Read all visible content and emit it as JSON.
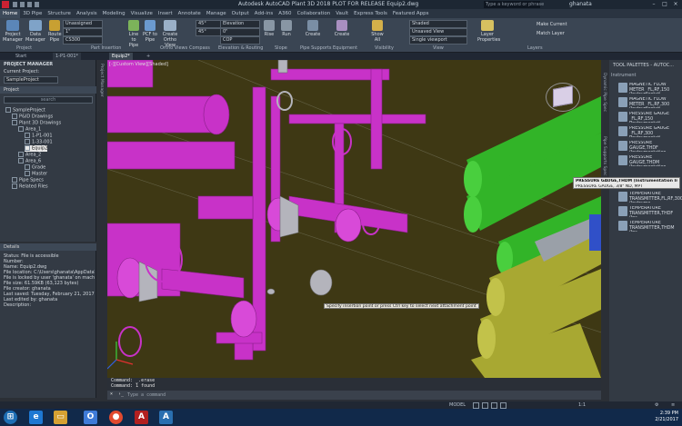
{
  "titlebar": {
    "title": "Autodesk AutoCAD Plant 3D 2018   PLOT FOR RELEASE   Equip2.dwg",
    "search_placeholder": "Type a keyword or phrase",
    "user": "ghanata"
  },
  "ribbon_tabs": [
    "Home",
    "3D Pipe",
    "Structure",
    "Analysis",
    "Modeling",
    "Visualize",
    "Insert",
    "Annotate",
    "Manage",
    "Output",
    "Add-ins",
    "A360",
    "Collaboration",
    "Vault",
    "Express Tools",
    "Featured Apps"
  ],
  "ribbon": {
    "buttons": {
      "project_manager": "Project Manager",
      "data_manager": "Data Manager",
      "route_pipe": "Route Pipe",
      "line_to_pipe": "Line to Pipe",
      "pcf_to_pipe": "PCF to Pipe",
      "create_ortho_view": "Create Ortho View",
      "rise": "Rise",
      "run": "Run",
      "create1": "Create",
      "create2": "Create",
      "show_all": "Show All",
      "layer_properties": "Layer Properties",
      "make_current": "Make Current",
      "match_layer": "Match Layer"
    },
    "selects": {
      "line_spec": "Unassigned",
      "size": "1\"",
      "spec": "CS300",
      "angle1": "45°",
      "angle2": "45°",
      "elevation_label": "Elevation",
      "elevation_value": "0\"",
      "cop": "COP",
      "visual_style": "Shaded",
      "view": "Unsaved View",
      "viewport": "Single viewport"
    },
    "groups": {
      "project": "Project",
      "part_insertion": "Part Insertion",
      "ortho_views": "Ortho Views",
      "compass": "Compass",
      "elevation_routing": "Elevation & Routing",
      "slope": "Slope",
      "pipe_supports": "Pipe Supports",
      "equipment": "Equipment",
      "visibility": "Visibility",
      "view": "View",
      "layers": "Layers"
    }
  },
  "file_tabs": [
    "Start",
    "1-P1-001*",
    "Equip2*"
  ],
  "project_manager": {
    "header": "PROJECT MANAGER",
    "current_project_label": "Current Project:",
    "current_project": "SampleProject",
    "panel_title": "Project",
    "search_placeholder": "search",
    "tree": [
      {
        "label": "SampleProject",
        "indent": 0
      },
      {
        "label": "P&ID Drawings",
        "indent": 1
      },
      {
        "label": "Plant 3D Drawings",
        "indent": 1
      },
      {
        "label": "Area_1",
        "indent": 2
      },
      {
        "label": "1-P1-001",
        "indent": 3
      },
      {
        "label": "1-33-001",
        "indent": 3
      },
      {
        "label": "Equip2",
        "indent": 3
      },
      {
        "label": "Area_2",
        "indent": 2
      },
      {
        "label": "Area_6",
        "indent": 2
      },
      {
        "label": "Grade",
        "indent": 3
      },
      {
        "label": "Master",
        "indent": 3
      },
      {
        "label": "Pipe Specs",
        "indent": 1
      },
      {
        "label": "Related Files",
        "indent": 1
      }
    ]
  },
  "details": {
    "header": "Details",
    "lines": [
      "Status: File is accessible",
      "Number:",
      "Name: Equip2.dwg",
      "File location: C:\\Users\\ghanata\\AppData\\Roam",
      "File is locked by user 'ghanata' on machine 'XXX",
      "File size: 61.59KB (63,123 bytes)",
      "File creator: ghanata",
      "Last saved: Tuesday, February 21, 2017 1:44:27",
      "Last edited by: ghanata",
      "Description:"
    ]
  },
  "viewport": {
    "label": "[-][Custom View][Shaded]",
    "prompt": "Specify insertion point or press Ctrl key to select next attachment point"
  },
  "command": {
    "line1": "Command: _.erase",
    "line2": "Command: 1 found",
    "placeholder": "Type a command"
  },
  "tool_palette": {
    "header": "TOOL PALETTES - AUTOC...",
    "section": "Instrument",
    "items": [
      "MAGNETIC FLOW METER _FL,RF,150 (Instrumentati",
      "MAGNETIC FLOW METER _FL,RF,300 (Instrumentati",
      "PRESSURE GAUGE _FL,RF,150 (Instrumentati",
      "PRESSURE GAUGE _FL,RF,300 (Instrumentati",
      "PRESSURE GAUGE,THDF (Instrumentation Imperial)",
      "PRESSURE GAUGE,THDM (Instrumentation Imperial)"
    ],
    "tooltip_title": "PRESSURE GAUGE,THDM (Instrumentation Imperial)",
    "tooltip_sub": "PRESSURE GAUGE, 3/8\" ND, MPT",
    "more_items": [
      "TEMPERATURE TRANSMITTER,FL,RF,300 (Instrume",
      "TEMPERATURE TRANSMITTER,THDF (Ins...",
      "TEMPERATURE TRANSMITTER,THDM (Ins..."
    ],
    "side_tabs": [
      "Dynamic Pipe Spec",
      "Pipe Supports Spec",
      "Valves",
      "Fittings",
      "Instruments"
    ]
  },
  "status": {
    "model": "MODEL",
    "scale": "1:1"
  },
  "taskbar": {
    "time": "2:39 PM",
    "date": "2/21/2017"
  },
  "colors": {
    "pipe_magenta": "#c832c8",
    "pipe_green": "#32b428",
    "pipe_olive": "#a8a832",
    "viewport_bg": "#3e3814"
  }
}
